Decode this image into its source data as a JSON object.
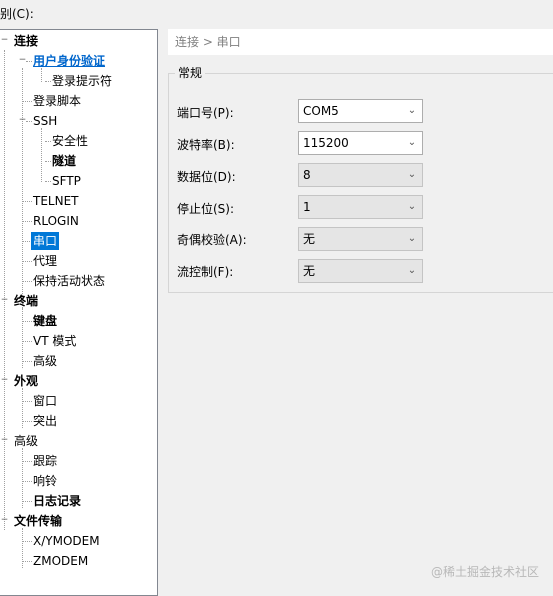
{
  "top": {
    "menu_label": "别(C):"
  },
  "tree": {
    "nodes": [
      {
        "label": "连接",
        "style": "bold",
        "expander": "−"
      },
      {
        "label": "用户身份验证",
        "style": "link",
        "expander": "−"
      },
      {
        "label": "登录提示符",
        "style": "normal"
      },
      {
        "label": "登录脚本",
        "style": "normal"
      },
      {
        "label": "SSH",
        "style": "normal",
        "expander": "−"
      },
      {
        "label": "安全性",
        "style": "normal"
      },
      {
        "label": "隧道",
        "style": "bold"
      },
      {
        "label": "SFTP",
        "style": "normal"
      },
      {
        "label": "TELNET",
        "style": "normal"
      },
      {
        "label": "RLOGIN",
        "style": "normal"
      },
      {
        "label": "串口",
        "style": "selected"
      },
      {
        "label": "代理",
        "style": "normal"
      },
      {
        "label": "保持活动状态",
        "style": "normal"
      },
      {
        "label": "终端",
        "style": "bold",
        "expander": "−"
      },
      {
        "label": "键盘",
        "style": "bold"
      },
      {
        "label": "VT 模式",
        "style": "normal"
      },
      {
        "label": "高级",
        "style": "normal"
      },
      {
        "label": "外观",
        "style": "bold",
        "expander": "−"
      },
      {
        "label": "窗口",
        "style": "normal"
      },
      {
        "label": "突出",
        "style": "normal"
      },
      {
        "label": "高级",
        "style": "normal",
        "expander": "−"
      },
      {
        "label": "跟踪",
        "style": "normal"
      },
      {
        "label": "响铃",
        "style": "normal"
      },
      {
        "label": "日志记录",
        "style": "bold"
      },
      {
        "label": "文件传输",
        "style": "bold",
        "expander": "−"
      },
      {
        "label": "X/YMODEM",
        "style": "normal"
      },
      {
        "label": "ZMODEM",
        "style": "normal"
      }
    ]
  },
  "breadcrumb": "连接 > 串口",
  "group": {
    "title": "常规"
  },
  "fields": [
    {
      "label": "端口号(P):",
      "value": "COM5",
      "enabled": true
    },
    {
      "label": "波特率(B):",
      "value": "115200",
      "enabled": true
    },
    {
      "label": "数据位(D):",
      "value": "8",
      "enabled": false
    },
    {
      "label": "停止位(S):",
      "value": "1",
      "enabled": false
    },
    {
      "label": "奇偶校验(A):",
      "value": "无",
      "enabled": false
    },
    {
      "label": "流控制(F):",
      "value": "无",
      "enabled": false
    }
  ],
  "watermark": "@稀土掘金技术社区",
  "icons": {
    "dropdown": "chevron-down-icon",
    "expander": "minus-box-icon"
  }
}
